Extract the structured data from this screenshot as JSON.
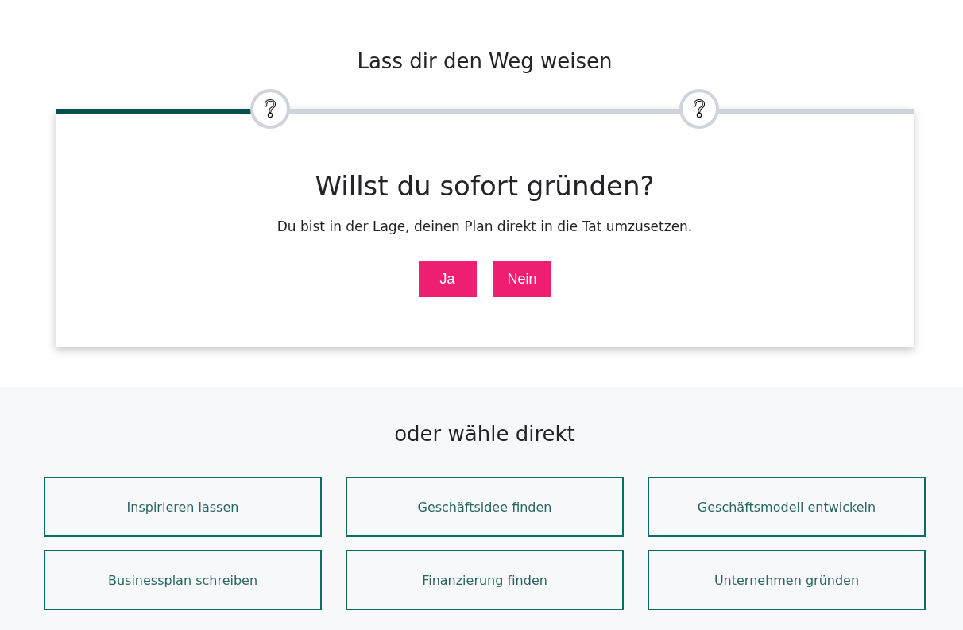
{
  "header": {
    "title": "Lass dir den Weg weisen"
  },
  "wizard": {
    "progress": {
      "level": 0.25
    },
    "steps": [
      {
        "kind": "question"
      },
      {
        "kind": "question"
      }
    ],
    "question": "Willst du sofort gründen?",
    "description": "Du bist in der Lage, deinen Plan direkt in die Tat umzusetzen.",
    "answers": [
      "Ja",
      "Nein"
    ]
  },
  "direct_choice": {
    "title": "oder wähle direkt",
    "links": [
      "Inspirieren lassen",
      "Geschäftsidee finden",
      "Geschäftsmodell entwickeln",
      "Businessplan schreiben",
      "Finanzierung finden",
      "Unternehmen gründen"
    ]
  }
}
